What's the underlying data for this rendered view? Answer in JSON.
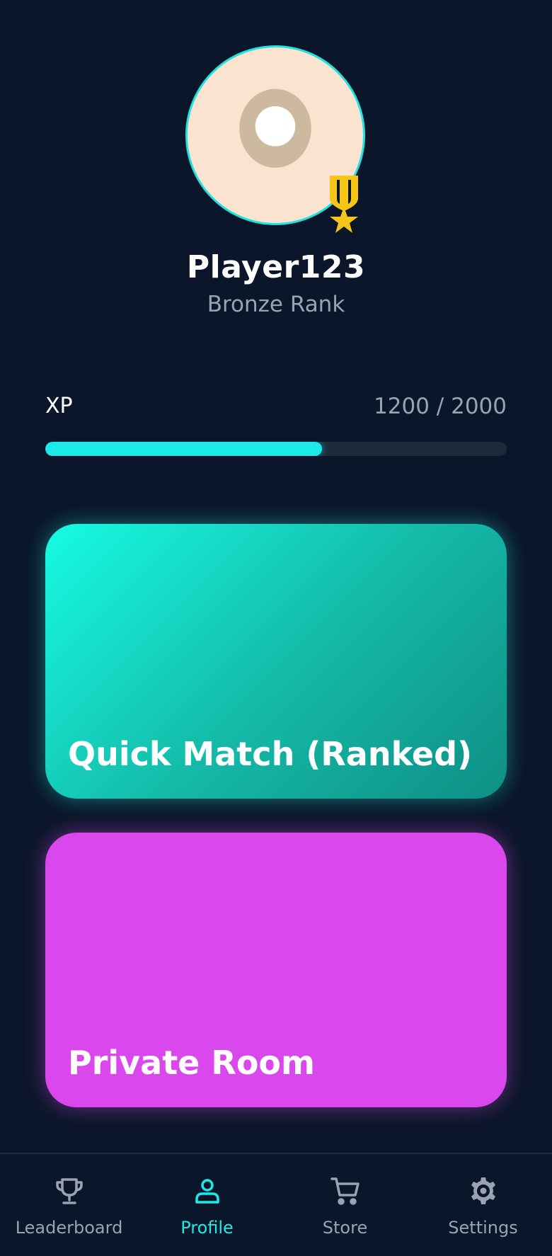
{
  "profile": {
    "name": "Player123",
    "rank": "Bronze Rank",
    "avatar_icon": "user-avatar-icon",
    "badge_icon": "medal-star-icon"
  },
  "xp": {
    "label": "XP",
    "current": 1200,
    "max": 2000,
    "text": "1200 / 2000",
    "progress": 0.6
  },
  "modes": {
    "quick_match": {
      "label": "Quick Match (Ranked)"
    },
    "private_room": {
      "label": "Private Room"
    }
  },
  "nav": {
    "items": [
      {
        "label": "Leaderboard",
        "icon": "trophy-icon",
        "active": false
      },
      {
        "label": "Profile",
        "icon": "person-icon",
        "active": true
      },
      {
        "label": "Store",
        "icon": "cart-icon",
        "active": false
      },
      {
        "label": "Settings",
        "icon": "gear-icon",
        "active": false
      }
    ]
  },
  "colors": {
    "background": "#0b162a",
    "accent": "#1de9e8",
    "quick_match_start": "#17fbe3",
    "quick_match_end": "#0f8f86",
    "private_room": "#da47ec",
    "badge": "#f5c518",
    "muted_text": "#9aa3b2"
  }
}
